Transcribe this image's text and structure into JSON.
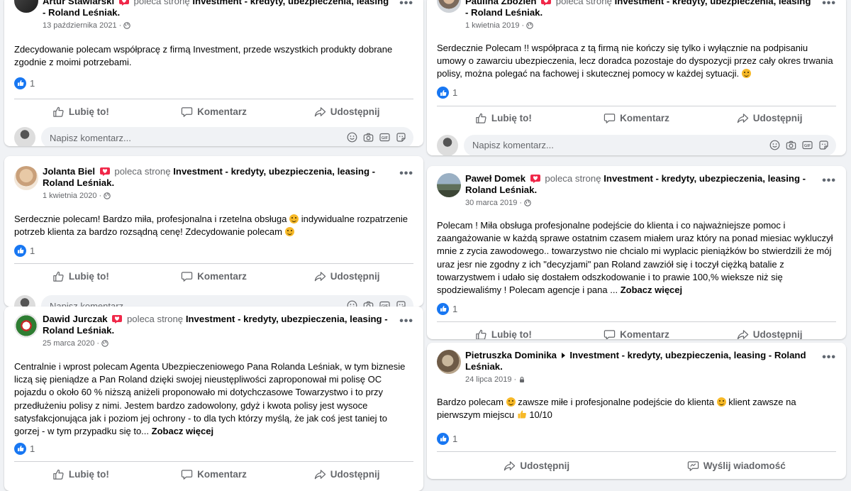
{
  "common": {
    "recommends": "poleca stronę",
    "page_name": "Investment - kredyty, ubezpieczenia, leasing - Roland Leśniak.",
    "like_label": "Lubię to!",
    "comment_label": "Komentarz",
    "share_label": "Udostępnij",
    "send_message_label": "Wyślij wiadomość",
    "comment_placeholder": "Napisz komentarz...",
    "see_more": "Zobacz więcej",
    "more_dots": "•••",
    "reaction_count": "1"
  },
  "posts": [
    {
      "author": "Artur Stawiarski",
      "date": "13 października 2021",
      "text": "Zdecydowanie polecam współpracę z firmą Investment, przede wszystkich produkty dobrane zgodnie z moimi potrzebami."
    },
    {
      "author": "Jolanta Biel",
      "date": "1 kwietnia 2020",
      "text_a": "Serdecznie polecam! Bardzo miła, profesjonalna i rzetelna obsługa",
      "text_b": "indywidualne rozpatrzenie potrzeb klienta za bardzo rozsądną cenę! Zdecydowanie polecam"
    },
    {
      "author": "Dawid Jurczak",
      "date": "25 marca 2020",
      "text": "Centralnie i wprost polecam Agenta Ubezpieczeniowego Pana Rolanda Leśniak, w tym biznesie liczą się pieniądze a Pan Roland dzięki swojej nieustępliwości zaproponował mi polisę OC pojazdu o około 60 % niższą aniżeli proponowało mi dotychczasowe Towarzystwo i to przy przedłużeniu polisy z nimi. Jestem bardzo zadowolony, gdyż i kwota polisy jest wysoce satysfakcjonująca jak i poziom jej ochrony - to dla tych którzy myślą, że jak coś jest taniej to gorzej - w tym przypadku się to..."
    },
    {
      "author": "Paulina Zbozień",
      "date": "1 kwietnia 2019",
      "text": "Serdecznie Polecam !! współpraca z tą firmą nie kończy się tylko i wyłącznie na podpisaniu umowy o zawarciu ubezpieczenia, lecz doradca pozostaje do dyspozycji przez cały okres trwania polisy, można polegać na fachowej i skutecznej pomocy w każdej sytuacji."
    },
    {
      "author": "Paweł Domek",
      "date": "30 marca 2019",
      "text": "Polecam ! Miła obsługa profesjonalne podejście do klienta i co najważniejsze pomoc i zaangażowanie w każdą sprawe ostatnim czasem miałem uraz który na ponad miesiac wykluczył mnie z zycia zawodowego.. towarzystwo nie chcialo mi wyplacic pieniążków bo stwierdzili że mój uraz jesr nie zgodny z ich \"decyzjami\" pan Roland zawziół się i toczył ciężką batalie z towarzystwem i udało się dostałem odszkodowanie i to prawie 100,% wieksze niż się spodziewaliśmy ! Polecam agencje i pana ..."
    },
    {
      "author": "Pietruszka Dominika",
      "page_name": "Investment - kredyty, ubezpieczenia, leasing - Roland Leśniak.",
      "date": "24 lipca 2019",
      "text_a": "Bardzo polecam",
      "text_b": "zawsze miłe i profesjonalne podejście do klienta",
      "text_c": "klient zawsze na pierwszym miejscu",
      "text_d": "10/10"
    }
  ]
}
